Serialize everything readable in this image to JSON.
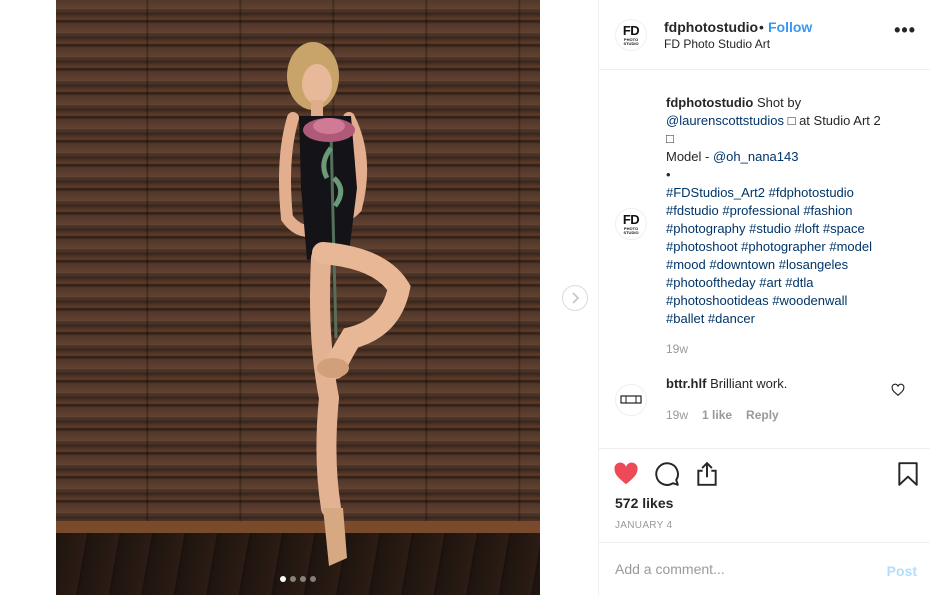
{
  "header": {
    "username": "fdphotostudio",
    "separator": "•",
    "follow_label": "Follow",
    "location": "FD Photo Studio Art",
    "more_label": "•••"
  },
  "logo": {
    "letters": "FD",
    "sub": "PHOTO STUDIO"
  },
  "caption": {
    "username": "fdphotostudio",
    "text_1": "Shot by",
    "mention_1": "@laurenscottstudios",
    "text_2": "□ at Studio Art 2",
    "text_3": "□",
    "model_label": "Model - ",
    "mention_2": "@oh_nana143",
    "bullet": "•",
    "hashtags": [
      "#FDStudios_Art2 #fdphotostudio",
      "#fdstudio #professional #fashion",
      "#photography #studio #loft #space",
      "#photoshoot #photographer #model",
      "#mood #downtown #losangeles",
      "#photooftheday #art #dtla",
      "#photoshootideas #woodenwall",
      "#ballet #dancer"
    ],
    "time": "19w"
  },
  "comment": {
    "username": "bttr.hlf",
    "text": "Brilliant work.",
    "time": "19w",
    "likes": "1 like",
    "reply_label": "Reply"
  },
  "actions": {
    "likes": "572 likes",
    "date": "JANUARY 4"
  },
  "add_comment": {
    "placeholder": "Add a comment...",
    "post_label": "Post"
  },
  "carousel": {
    "count": 4,
    "active": 0
  },
  "colors": {
    "accent": "#3897f0",
    "like_red": "#ed4956",
    "hashtag": "#003569",
    "muted": "#999999",
    "post_disabled": "#b2dffc"
  }
}
